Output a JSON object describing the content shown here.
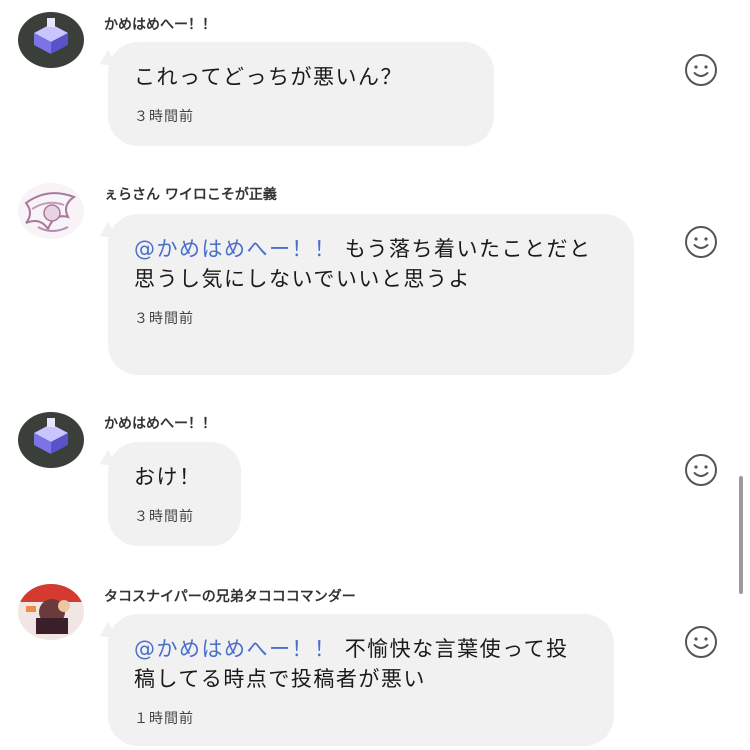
{
  "comments": [
    {
      "author": "かめはめへー！！",
      "text": "これってどっちが悪いん？",
      "mention": "",
      "time": "３時間前",
      "avatar_icon": "lilac-building-avatar-icon"
    },
    {
      "author": "ぇらさん ワイロこそが正義",
      "text": "もう落ち着いたことだと思うし気にしないでいいと思うよ",
      "mention": "@かめはめへー！！",
      "time": "３時間前",
      "avatar_icon": "sketch-character-avatar-icon"
    },
    {
      "author": "かめはめへー！！",
      "text": "おけ！",
      "mention": "",
      "time": "３時間前",
      "avatar_icon": "lilac-building-avatar-icon"
    },
    {
      "author": "タコスナイパーの兄弟タコココマンダー",
      "text": "不愉快な言葉使って投稿してる時点で投稿者が悪い",
      "mention": "@かめはめへー！！",
      "time": "１時間前",
      "avatar_icon": "red-character-avatar-icon"
    }
  ],
  "react_icon": "smiley-face-icon",
  "colors": {
    "mention": "#4a6fc9",
    "bubble": "#f1f1f1",
    "text": "#1a1a1a"
  }
}
